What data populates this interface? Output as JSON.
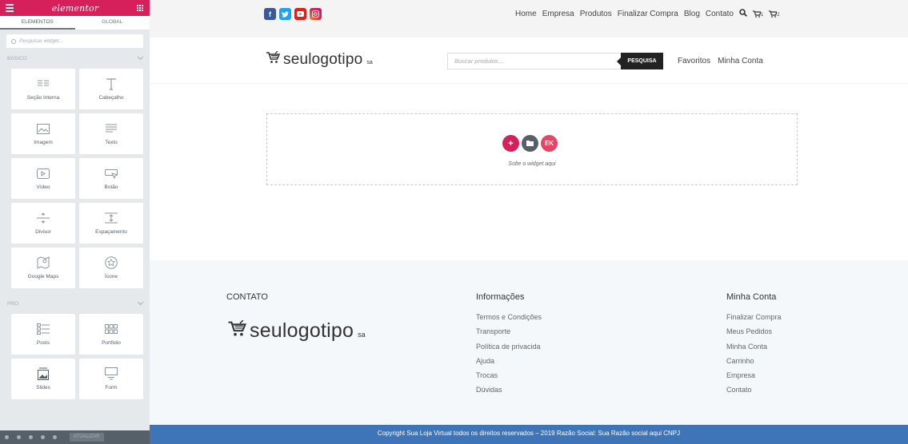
{
  "colors": {
    "brand": "#d5205b",
    "footer_bar": "#3e74b8",
    "panel": "#e6e9ec"
  },
  "sidebar": {
    "logo": "elementor",
    "tabs": [
      {
        "label": "ELEMENTOS"
      },
      {
        "label": "GLOBAL"
      }
    ],
    "search_placeholder": "Pesquisar widget...",
    "cat_basic": "BÁSICO",
    "cat_pro": "PRO",
    "widgets_basic": [
      {
        "label": "Seção Interna",
        "icon": "inner-section-icon"
      },
      {
        "label": "Cabeçalho",
        "icon": "heading-icon"
      },
      {
        "label": "Imagem",
        "icon": "image-icon"
      },
      {
        "label": "Texto",
        "icon": "text-editor-icon"
      },
      {
        "label": "Vídeo",
        "icon": "video-icon"
      },
      {
        "label": "Botão",
        "icon": "button-icon"
      },
      {
        "label": "Divisor",
        "icon": "divider-icon"
      },
      {
        "label": "Espaçamento",
        "icon": "spacer-icon"
      },
      {
        "label": "Google Maps",
        "icon": "map-icon"
      },
      {
        "label": "Ícone",
        "icon": "star-icon"
      }
    ],
    "widgets_pro": [
      {
        "label": "Posts",
        "icon": "posts-icon"
      },
      {
        "label": "Portfolio",
        "icon": "portfolio-icon"
      },
      {
        "label": "Slides",
        "icon": "slides-icon"
      },
      {
        "label": "Form",
        "icon": "form-icon"
      }
    ],
    "update_label": "ATUALIZAR"
  },
  "topbar": {
    "nav": [
      "Home",
      "Empresa",
      "Produtos",
      "Finalizar Compra",
      "Blog",
      "Contato"
    ],
    "cart_count_1": "1",
    "cart_count_2": "2"
  },
  "header": {
    "logo_text": "seulogotipo",
    "logo_suffix": "sa",
    "search_placeholder": "Buscar produtos...",
    "search_button": "PESQUISA",
    "links": [
      "Favoritos",
      "Minha Conta"
    ]
  },
  "dropzone": {
    "text": "Solte o widget aqui"
  },
  "footer": {
    "contact_title": "CONTATO",
    "info_title": "Informações",
    "info_links": [
      "Termos e Condições",
      "Transporte",
      "Política de privacida",
      "Ajuda",
      "Trocas",
      "Dúvidas"
    ],
    "account_title": "Minha Conta",
    "account_links": [
      "Finalizar Compra",
      "Meus Pedidos",
      "Minha Conta",
      "Carrinho",
      "Empresa",
      "Contato"
    ],
    "copyright": "Copyright Sua Loja Virtual todos os direitos reservados – 2019 Razão Social: Sua Razão social aqui CNPJ"
  }
}
